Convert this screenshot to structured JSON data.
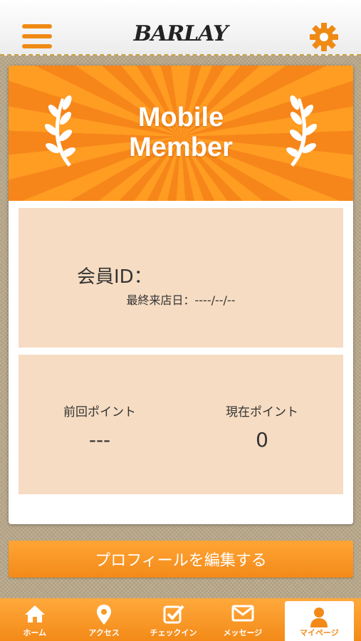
{
  "header": {
    "logo_text": "BARLAY",
    "menu_icon": "hamburger-menu-icon",
    "settings_icon": "gear-icon"
  },
  "card": {
    "banner_title_line1": "Mobile",
    "banner_title_line2": "Member",
    "member_id_label": "会員ID：",
    "last_visit_label": "最終来店日：----/--/--",
    "previous_points_label": "前回ポイント",
    "previous_points_value": "---",
    "current_points_label": "現在ポイント",
    "current_points_value": "0"
  },
  "edit_profile_button": "プロフィールを編集する",
  "tabs": [
    {
      "label": "ホーム",
      "icon": "home-icon"
    },
    {
      "label": "アクセス",
      "icon": "map-pin-icon"
    },
    {
      "label": "チェックイン",
      "icon": "checkbox-icon"
    },
    {
      "label": "メッセージ",
      "icon": "envelope-icon"
    },
    {
      "label": "マイページ",
      "icon": "user-icon"
    }
  ],
  "colors": {
    "accent": "#f38a18",
    "panel": "#f6dcc3",
    "background": "#b9a88a"
  }
}
